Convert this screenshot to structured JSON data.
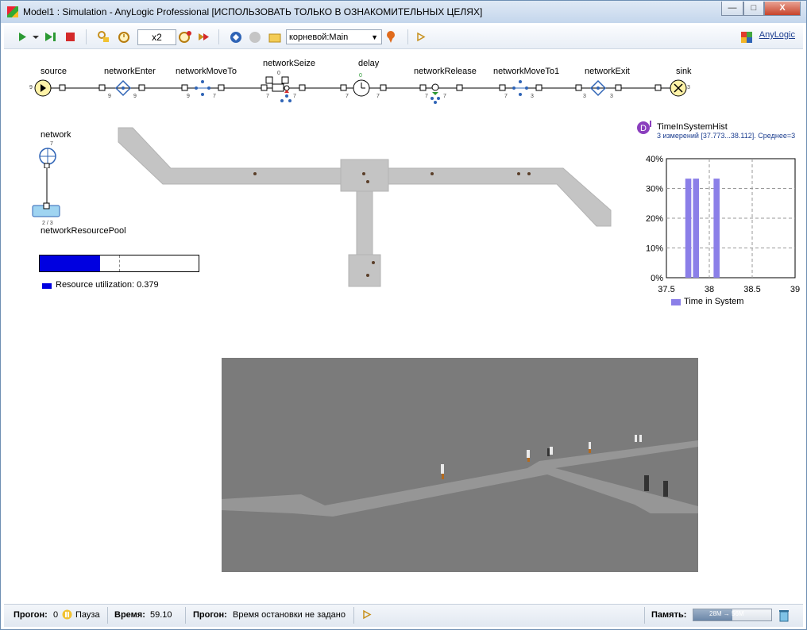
{
  "window": {
    "title": "Model1 : Simulation - AnyLogic Professional [ИСПОЛЬЗОВАТЬ ТОЛЬКО В ОЗНАКОМИТЕЛЬНЫХ ЦЕЛЯХ]",
    "min_glyph": "—",
    "max_glyph": "□",
    "close_glyph": "X"
  },
  "toolbar": {
    "speed": "x2",
    "experiment_select": "корневой:Main",
    "brand": "AnyLogic",
    "icons": [
      "play-icon",
      "play-dropdown-icon",
      "step-icon",
      "stop-icon",
      "wrench-icon",
      "clock-icon",
      "speed-down-icon",
      "speed-up-icon",
      "navigate-icon",
      "back-icon",
      "folder-icon",
      "pin-icon",
      "play-small-icon"
    ]
  },
  "flowchart": {
    "blocks": [
      {
        "name": "source",
        "count": "9"
      },
      {
        "name": "networkEnter",
        "count": "9"
      },
      {
        "name": "networkMoveTo",
        "count_in": "9",
        "count_out": "7"
      },
      {
        "name": "networkSeize",
        "count_in": "7",
        "count_out": "7",
        "queue": "0",
        "top_count": "0"
      },
      {
        "name": "delay",
        "count_in": "7",
        "count_out": "7",
        "top_count": "0"
      },
      {
        "name": "networkRelease",
        "count_in": "7",
        "count_out": "7"
      },
      {
        "name": "networkMoveTo1",
        "count_in": "7",
        "count_out": "3"
      },
      {
        "name": "networkExit",
        "count_in": "3",
        "count_out": "3"
      },
      {
        "name": "sink",
        "count": "3"
      }
    ],
    "network_label": "network",
    "network_count": "7",
    "pool_label": "networkResourcePool",
    "pool_count": "2 / 3"
  },
  "utilization": {
    "label": "Resource utilization: 0.379",
    "value": 0.379,
    "color": "#0000e0"
  },
  "histogram": {
    "title": "TimeInSystemHist",
    "subtitle": "3 измерений [37.773...38.112]. Среднее=3",
    "legend": "Time in System",
    "bar_color": "#8b7fe8"
  },
  "chart_data": {
    "type": "bar",
    "title": "TimeInSystemHist",
    "x_ticks": [
      "37.5",
      "38",
      "38.5",
      "39"
    ],
    "y_ticks": [
      "0%",
      "10%",
      "20%",
      "30%",
      "40%"
    ],
    "xlim": [
      37.5,
      39
    ],
    "ylim": [
      0,
      40
    ],
    "bars": [
      {
        "x0": 37.72,
        "x1": 37.79,
        "value": 33.3
      },
      {
        "x0": 37.81,
        "x1": 37.88,
        "value": 33.3
      },
      {
        "x0": 38.05,
        "x1": 38.12,
        "value": 33.3
      }
    ],
    "series": [
      {
        "name": "Time in System"
      }
    ],
    "grid": true,
    "legend_position": "bottom"
  },
  "status": {
    "run_label": "Прогон:",
    "run_value": "0",
    "pause_label": "Пауза",
    "time_label": "Время:",
    "time_value": "59.10",
    "run2_label": "Прогон:",
    "stop_label": "Время остановки не задано",
    "mem_label": "Память:",
    "mem_value": "28M → 56M",
    "mem_fraction": 0.5
  }
}
